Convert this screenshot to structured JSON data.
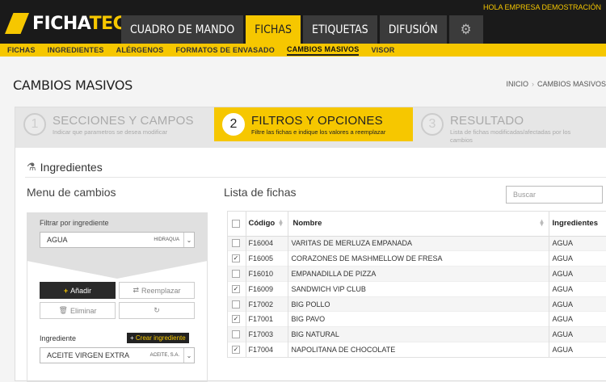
{
  "app": {
    "logo_prefix": "FICHA",
    "logo_suffix": "TEC",
    "user": "HOLA EMPRESA DEMOSTRACIÓN"
  },
  "main_nav": [
    {
      "label": "CUADRO DE MANDO",
      "active": false
    },
    {
      "label": "FICHAS",
      "active": true
    },
    {
      "label": "ETIQUETAS",
      "active": false
    },
    {
      "label": "DIFUSIÓN",
      "active": false
    }
  ],
  "gear_icon": "gear-icon",
  "sub_nav": [
    {
      "label": "FICHAS",
      "active": false
    },
    {
      "label": "INGREDIENTES",
      "active": false
    },
    {
      "label": "ALÉRGENOS",
      "active": false
    },
    {
      "label": "FORMATOS DE ENVASADO",
      "active": false
    },
    {
      "label": "CAMBIOS MASIVOS",
      "active": true
    },
    {
      "label": "VISOR",
      "active": false
    }
  ],
  "page": {
    "title": "CAMBIOS MASIVOS",
    "breadcrumb": [
      "INICIO",
      "CAMBIOS MASIVOS"
    ]
  },
  "wizard": [
    {
      "num": "1",
      "title": "SECCIONES Y CAMPOS",
      "desc": "Indicar que parametros se desea modificar",
      "active": false
    },
    {
      "num": "2",
      "title": "FILTROS Y OPCIONES",
      "desc": "Filtre las fichas e indique los valores a reemplazar",
      "active": true
    },
    {
      "num": "3",
      "title": "RESULTADO",
      "desc": "Lista de fichas modificadas/afectadas por los cambios",
      "active": false
    }
  ],
  "section": {
    "title": "Ingredientes",
    "icon": "flask-icon"
  },
  "left": {
    "title": "Menu de cambios",
    "filter_label": "Filtrar por ingrediente",
    "filter_value": "AGUA",
    "filter_sub": "HIDRAQUA",
    "add_label": "Añadir",
    "replace_label": "Reemplazar",
    "remove_label": "Eliminar",
    "ingredient_label": "Ingrediente",
    "create_label": "Crear ingrediente",
    "ingredient_value": "ACEITE VIRGEN EXTRA",
    "ingredient_sub": "ACEITE, S.A."
  },
  "right": {
    "title": "Lista de fichas",
    "search_placeholder": "Buscar",
    "columns": [
      "Código",
      "Nombre",
      "Ingredientes"
    ],
    "rows": [
      {
        "checked": false,
        "code": "F16004",
        "name": "VARITAS DE MERLUZA EMPANADA",
        "ing": "AGUA"
      },
      {
        "checked": true,
        "code": "F16005",
        "name": "CORAZONES DE MASHMELLOW DE FRESA",
        "ing": "AGUA"
      },
      {
        "checked": false,
        "code": "F16010",
        "name": "EMPANADILLA DE PIZZA",
        "ing": "AGUA"
      },
      {
        "checked": true,
        "code": "F16009",
        "name": "SANDWICH VIP CLUB",
        "ing": "AGUA"
      },
      {
        "checked": false,
        "code": "F17002",
        "name": "BIG POLLO",
        "ing": "AGUA"
      },
      {
        "checked": true,
        "code": "F17001",
        "name": "BIG PAVO",
        "ing": "AGUA"
      },
      {
        "checked": false,
        "code": "F17003",
        "name": "BIG NATURAL",
        "ing": "AGUA"
      },
      {
        "checked": true,
        "code": "F17004",
        "name": "NAPOLITANA DE CHOCOLATE",
        "ing": "AGUA"
      }
    ]
  },
  "colors": {
    "accent": "#f6c700",
    "dark": "#1a1a1a"
  }
}
